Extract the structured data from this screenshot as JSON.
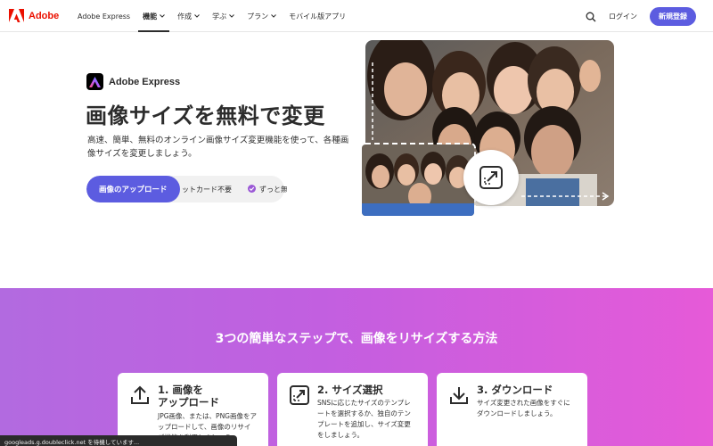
{
  "header": {
    "logo_text": "Adobe",
    "nav": [
      {
        "label": "Adobe Express",
        "has_chevron": false,
        "active": false
      },
      {
        "label": "機能",
        "has_chevron": true,
        "active": true
      },
      {
        "label": "作成",
        "has_chevron": true,
        "active": false
      },
      {
        "label": "学ぶ",
        "has_chevron": true,
        "active": false
      },
      {
        "label": "プラン",
        "has_chevron": true,
        "active": false
      },
      {
        "label": "モバイル版アプリ",
        "has_chevron": false,
        "active": false
      }
    ],
    "login_label": "ログイン",
    "signup_label": "新規登録"
  },
  "hero": {
    "brand_name": "Adobe Express",
    "title": "画像サイズを無料で変更",
    "description": "高速、簡単、無料のオンライン画像サイズ変更機能を使って、各種画像サイズを変更しましょう。",
    "upload_button": "画像のアップロード",
    "no_card_text": "ットカード不要",
    "free_forever_text": "ずっと無"
  },
  "steps": {
    "title": "3つの簡単なステップで、画像をリサイズする方法",
    "cards": [
      {
        "icon": "upload-icon",
        "title_line1": "1. 画像を",
        "title_line2": "アップロード",
        "desc_lines": [
          "JPG画像、または、PNG画像をア",
          "ップロードして、画像のリサイ",
          "ズ機能を利用しましょう。"
        ]
      },
      {
        "icon": "resize-icon",
        "title_line1": "2. サイズ選択",
        "title_line2": "",
        "desc_lines": [
          "SNSに応じたサイズのテンプレ",
          "ートを選択するか、独自のテン",
          "プレートを追加し、サイズ変更",
          "をしましょう。"
        ]
      },
      {
        "icon": "download-icon",
        "title_line1": "3. ダウンロード",
        "title_line2": "",
        "desc_lines": [
          "サイズ変更された画像をすぐに",
          "ダウンロードしましょう。"
        ]
      }
    ]
  },
  "status_bar": "googleads.g.doubleclick.net を待機しています...",
  "colors": {
    "adobe_red": "#eb1000",
    "primary_purple": "#5c5ce0",
    "gradient_start": "#b26ae0",
    "gradient_end": "#e65ad8"
  }
}
